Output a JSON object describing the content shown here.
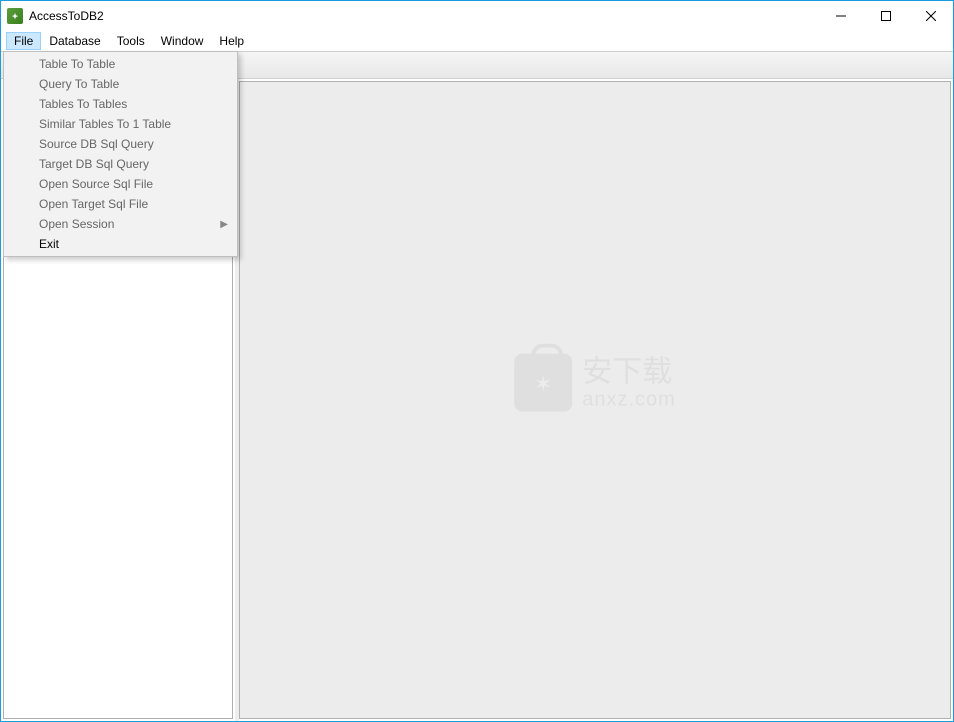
{
  "window": {
    "title": "AccessToDB2"
  },
  "menubar": {
    "items": [
      "File",
      "Database",
      "Tools",
      "Window",
      "Help"
    ],
    "active_index": 0
  },
  "file_menu": {
    "items": [
      {
        "label": "Table To Table",
        "has_submenu": false
      },
      {
        "label": "Query To Table",
        "has_submenu": false
      },
      {
        "label": "Tables To Tables",
        "has_submenu": false
      },
      {
        "label": "Similar Tables To 1 Table",
        "has_submenu": false
      },
      {
        "label": "Source DB Sql Query",
        "has_submenu": false
      },
      {
        "label": "Target DB Sql Query",
        "has_submenu": false
      },
      {
        "label": "Open Source Sql File",
        "has_submenu": false
      },
      {
        "label": "Open Target Sql File",
        "has_submenu": false
      },
      {
        "label": "Open Session",
        "has_submenu": true
      },
      {
        "label": "Exit",
        "has_submenu": false,
        "strong": true
      }
    ]
  },
  "watermark": {
    "cn": "安下载",
    "en": "anxz.com"
  }
}
